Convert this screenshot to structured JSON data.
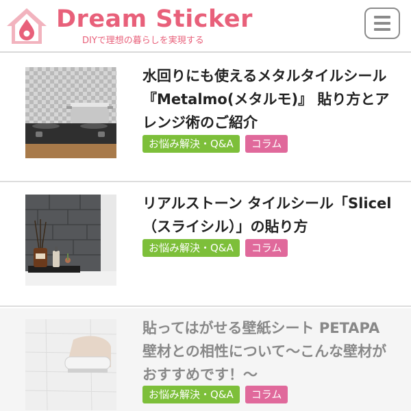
{
  "header": {
    "brand_name": "Dream Sticker",
    "tagline": "DIYで理想の暮らしを実現する",
    "menu_icon": "hamburger-icon",
    "brand_color": "#e8607a"
  },
  "articles": [
    {
      "title": "水回りにも使えるメタルタイルシール『Metalmo(メタルモ)』 貼り方とアレンジ術のご紹介",
      "tags": [
        "お悩み解決・Q&A",
        "コラム"
      ],
      "thumbnail": "kitchen-stove-metal-tile-image"
    },
    {
      "title": "リアルストーン タイルシール「Slicel（スライシル）」の貼り方",
      "tags": [
        "お悩み解決・Q&A",
        "コラム"
      ],
      "thumbnail": "stone-tile-diffuser-image"
    },
    {
      "title": "貼ってはがせる壁紙シート PETAPA 壁材との相性について〜こんな壁材がおすすめです！〜",
      "tags": [
        "お悩み解決・Q&A",
        "コラム"
      ],
      "thumbnail": "wall-sheet-peel-image"
    }
  ],
  "colors": {
    "tag_green": "#7dbf3a",
    "tag_pink": "#e0699b"
  }
}
